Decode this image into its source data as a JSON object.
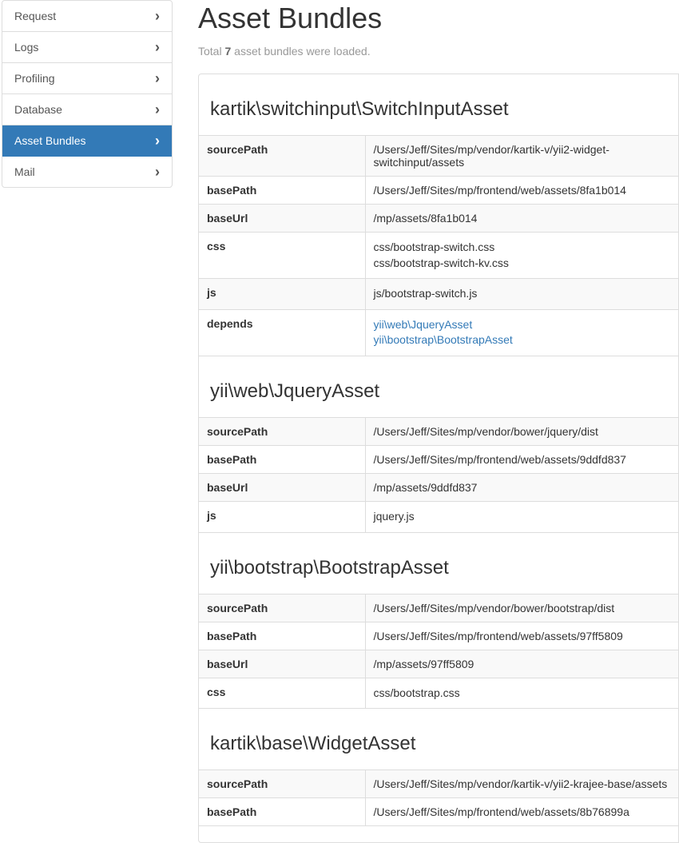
{
  "sidebar": {
    "items": [
      {
        "label": "Request",
        "active": false
      },
      {
        "label": "Logs",
        "active": false
      },
      {
        "label": "Profiling",
        "active": false
      },
      {
        "label": "Database",
        "active": false
      },
      {
        "label": "Asset Bundles",
        "active": true
      },
      {
        "label": "Mail",
        "active": false
      }
    ]
  },
  "page": {
    "title": "Asset Bundles",
    "subtitle_before": "Total ",
    "subtitle_count": "7",
    "subtitle_after": " asset bundles were loaded."
  },
  "bundles": [
    {
      "name": "kartik\\switchinput\\SwitchInputAsset",
      "rows": [
        {
          "key": "sourcePath",
          "type": "text",
          "value": "/Users/Jeff/Sites/mp/vendor/kartik-v/yii2-widget-switchinput/assets"
        },
        {
          "key": "basePath",
          "type": "text",
          "value": "/Users/Jeff/Sites/mp/frontend/web/assets/8fa1b014"
        },
        {
          "key": "baseUrl",
          "type": "text",
          "value": "/mp/assets/8fa1b014"
        },
        {
          "key": "css",
          "type": "list",
          "values": [
            "css/bootstrap-switch.css",
            "css/bootstrap-switch-kv.css"
          ]
        },
        {
          "key": "js",
          "type": "list",
          "values": [
            "js/bootstrap-switch.js"
          ]
        },
        {
          "key": "depends",
          "type": "links",
          "values": [
            "yii\\web\\JqueryAsset",
            "yii\\bootstrap\\BootstrapAsset"
          ]
        }
      ]
    },
    {
      "name": "yii\\web\\JqueryAsset",
      "rows": [
        {
          "key": "sourcePath",
          "type": "text",
          "value": "/Users/Jeff/Sites/mp/vendor/bower/jquery/dist"
        },
        {
          "key": "basePath",
          "type": "text",
          "value": "/Users/Jeff/Sites/mp/frontend/web/assets/9ddfd837"
        },
        {
          "key": "baseUrl",
          "type": "text",
          "value": "/mp/assets/9ddfd837"
        },
        {
          "key": "js",
          "type": "list",
          "values": [
            "jquery.js"
          ]
        }
      ]
    },
    {
      "name": "yii\\bootstrap\\BootstrapAsset",
      "rows": [
        {
          "key": "sourcePath",
          "type": "text",
          "value": "/Users/Jeff/Sites/mp/vendor/bower/bootstrap/dist"
        },
        {
          "key": "basePath",
          "type": "text",
          "value": "/Users/Jeff/Sites/mp/frontend/web/assets/97ff5809"
        },
        {
          "key": "baseUrl",
          "type": "text",
          "value": "/mp/assets/97ff5809"
        },
        {
          "key": "css",
          "type": "list",
          "values": [
            "css/bootstrap.css"
          ]
        }
      ]
    },
    {
      "name": "kartik\\base\\WidgetAsset",
      "rows": [
        {
          "key": "sourcePath",
          "type": "text",
          "value": "/Users/Jeff/Sites/mp/vendor/kartik-v/yii2-krajee-base/assets"
        },
        {
          "key": "basePath",
          "type": "text",
          "value": "/Users/Jeff/Sites/mp/frontend/web/assets/8b76899a"
        }
      ]
    }
  ]
}
